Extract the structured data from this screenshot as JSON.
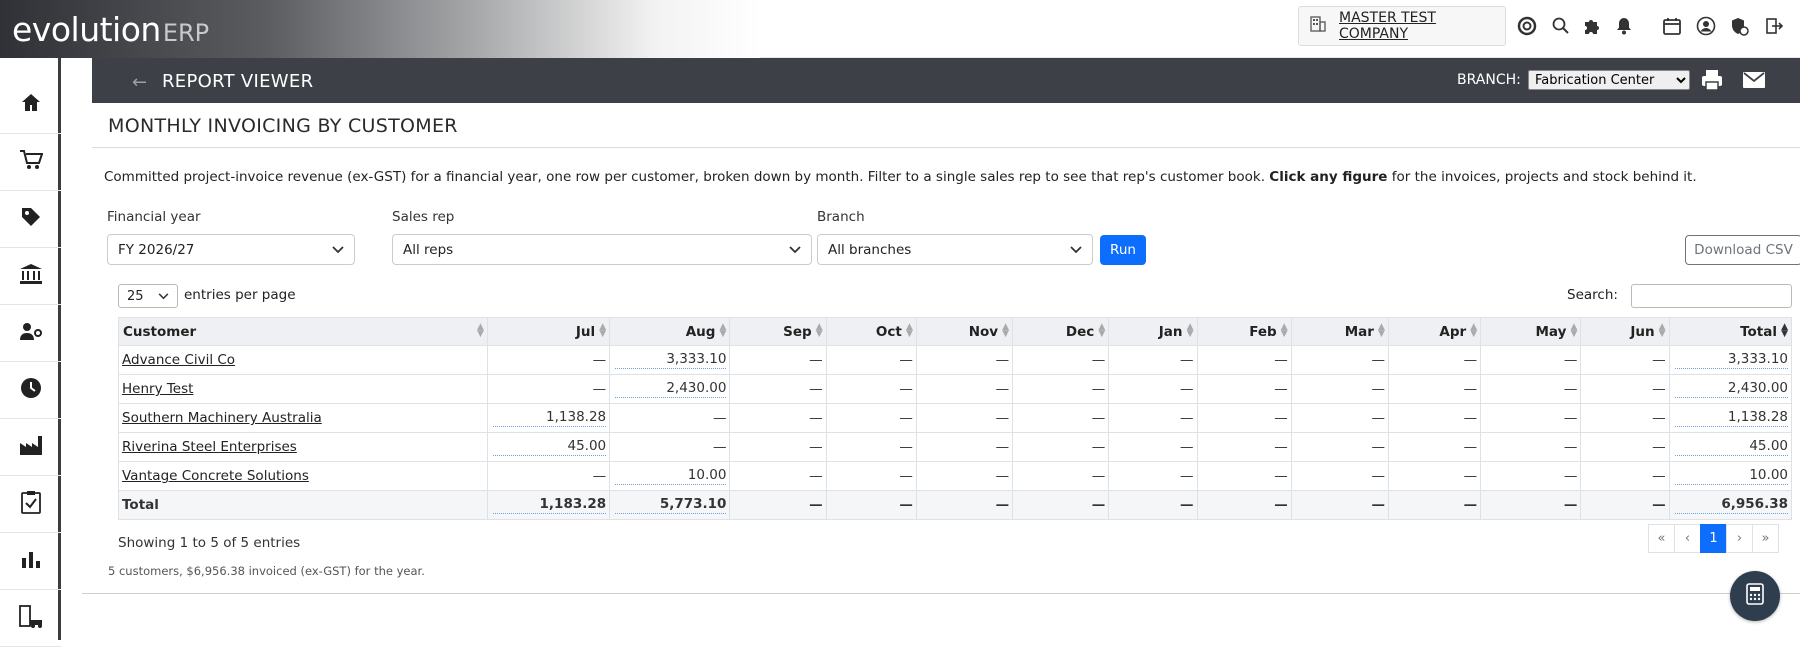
{
  "app": {
    "logo_main": "evolution",
    "logo_suffix": "ERP"
  },
  "topbar": {
    "company_name": "MASTER TEST COMPANY",
    "icons": [
      "building-icon",
      "support-icon",
      "search-icon",
      "puzzle-icon",
      "bell-icon",
      "calendar-icon",
      "user-icon",
      "shield-icon",
      "logout-icon"
    ]
  },
  "sidebar": {
    "items": [
      "home-icon",
      "cart-icon",
      "tag-icon",
      "bank-icon",
      "user-gear-icon",
      "clock-icon",
      "factory-icon",
      "clipboard-check-icon",
      "bar-chart-icon",
      "building-car-icon"
    ]
  },
  "report_viewer": {
    "title": "REPORT VIEWER",
    "branch_label": "BRANCH:",
    "branch_value": "Fabrication Center"
  },
  "report": {
    "title": "MONTHLY INVOICING BY CUSTOMER",
    "desc_text": "Committed project-invoice revenue (ex-GST) for a financial year, one row per customer, broken down by month. Filter to a single sales rep to see that rep's customer book.",
    "desc_bold": "Click any figure",
    "desc_tail": "for the invoices, projects and stock behind it."
  },
  "filters": {
    "fy_label": "Financial year",
    "fy_value": "FY 2026/27",
    "rep_label": "Sales rep",
    "rep_value": "All reps",
    "branch_label": "Branch",
    "branch_value": "All branches",
    "run_label": "Run",
    "download_label": "Download CSV"
  },
  "table_controls": {
    "per_page": "25",
    "per_page_label": "entries per page",
    "search_label": "Search:"
  },
  "table": {
    "headers": [
      "Customer",
      "Jul",
      "Aug",
      "Sep",
      "Oct",
      "Nov",
      "Dec",
      "Jan",
      "Feb",
      "Mar",
      "Apr",
      "May",
      "Jun",
      "Total"
    ],
    "rows": [
      [
        "Advance Civil Co",
        "—",
        "3,333.10",
        "—",
        "—",
        "—",
        "—",
        "—",
        "—",
        "—",
        "—",
        "—",
        "—",
        "3,333.10"
      ],
      [
        "Henry Test",
        "—",
        "2,430.00",
        "—",
        "—",
        "—",
        "—",
        "—",
        "—",
        "—",
        "—",
        "—",
        "—",
        "2,430.00"
      ],
      [
        "Southern Machinery Australia",
        "1,138.28",
        "—",
        "—",
        "—",
        "—",
        "—",
        "—",
        "—",
        "—",
        "—",
        "—",
        "—",
        "1,138.28"
      ],
      [
        "Riverina Steel Enterprises",
        "45.00",
        "—",
        "—",
        "—",
        "—",
        "—",
        "—",
        "—",
        "—",
        "—",
        "—",
        "—",
        "45.00"
      ],
      [
        "Vantage Concrete Solutions",
        "—",
        "10.00",
        "—",
        "—",
        "—",
        "—",
        "—",
        "—",
        "—",
        "—",
        "—",
        "—",
        "10.00"
      ]
    ],
    "total_row": [
      "Total",
      "1,183.28",
      "5,773.10",
      "—",
      "—",
      "—",
      "—",
      "—",
      "—",
      "—",
      "—",
      "—",
      "—",
      "6,956.38"
    ]
  },
  "footer": {
    "showing": "Showing 1 to 5 of 5 entries",
    "pager": [
      "«",
      "‹",
      "1",
      "›",
      "»"
    ],
    "summary": "5 customers, $6,956.38 invoiced (ex-GST) for the year."
  },
  "colors": {
    "accent": "#0d6efd",
    "header_bar": "#3d4046",
    "fab": "#2f3e4e"
  }
}
